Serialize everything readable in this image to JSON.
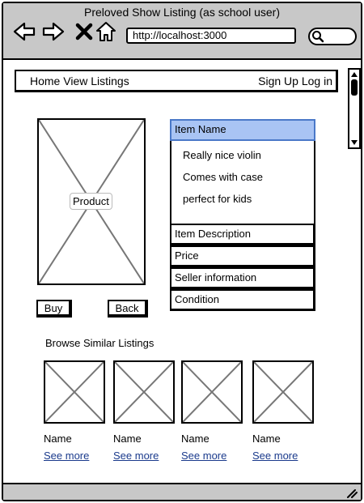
{
  "window": {
    "title": "Preloved Show Listing (as school user)"
  },
  "browser": {
    "url": "http://localhost:3000",
    "icons": [
      "back-arrow-icon",
      "forward-arrow-icon",
      "close-x-icon",
      "home-icon",
      "search-icon"
    ]
  },
  "menu": {
    "left": [
      "Home",
      "View Listings"
    ],
    "right": [
      "Sign Up",
      "Log in"
    ]
  },
  "product": {
    "image_label": "Product",
    "buy_label": "Buy",
    "back_label": "Back"
  },
  "details": {
    "sections": [
      "Item Name",
      "Item Description",
      "Price",
      "Seller information",
      "Condition"
    ],
    "active_section": "Item Name",
    "item_name_lines": [
      "Really nice violin",
      "Comes with case",
      "perfect for kids"
    ]
  },
  "similar": {
    "title": "Browse Similar Listings",
    "items": [
      {
        "name": "Name",
        "link": "See more"
      },
      {
        "name": "Name",
        "link": "See more"
      },
      {
        "name": "Name",
        "link": "See more"
      },
      {
        "name": "Name",
        "link": "See more"
      }
    ]
  },
  "colors": {
    "chrome": "#c8c8c8",
    "accent": "#a9c4f4",
    "link": "#1a3a8c"
  }
}
